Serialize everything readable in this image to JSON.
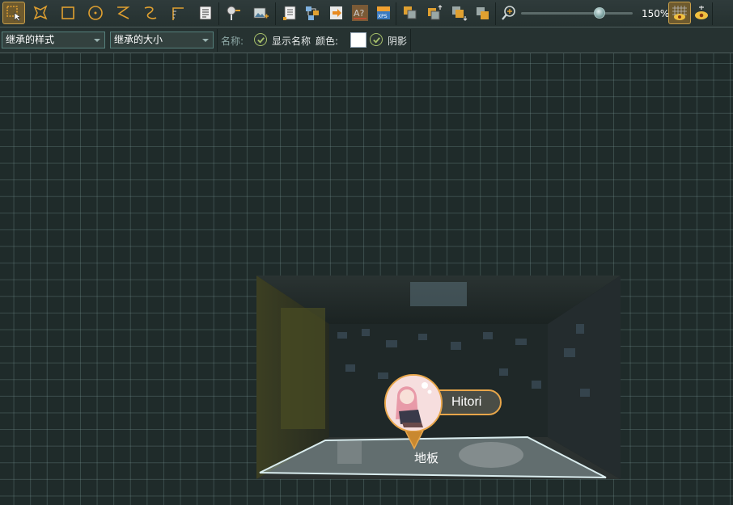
{
  "toolbar": {
    "tools": [
      {
        "name": "select-tool",
        "active": true
      },
      {
        "name": "polygon-tool"
      },
      {
        "name": "rectangle-tool"
      },
      {
        "name": "circle-tool"
      },
      {
        "name": "line-tool"
      },
      {
        "name": "curve-tool"
      },
      {
        "name": "path-tool"
      },
      {
        "name": "text-tool"
      },
      {
        "name": "marker-tool"
      },
      {
        "name": "image-tool"
      }
    ],
    "zoom": {
      "value_label": "150%",
      "level": 0.7
    }
  },
  "propbar": {
    "style_select": "继承的样式",
    "size_select": "继承的大小",
    "name_label": "名称:",
    "show_name_checked": true,
    "show_name_label": "显示名称",
    "color_label": "颜色:",
    "color_value": "#ffffff",
    "shadow_checked": true,
    "shadow_label": "阴影"
  },
  "canvas": {
    "marker_name": "Hitori",
    "floor_label": "地板"
  },
  "colors": {
    "accent": "#e8a64a",
    "check": "#a6c06a",
    "canvas_bg": "#1f2b2a"
  }
}
